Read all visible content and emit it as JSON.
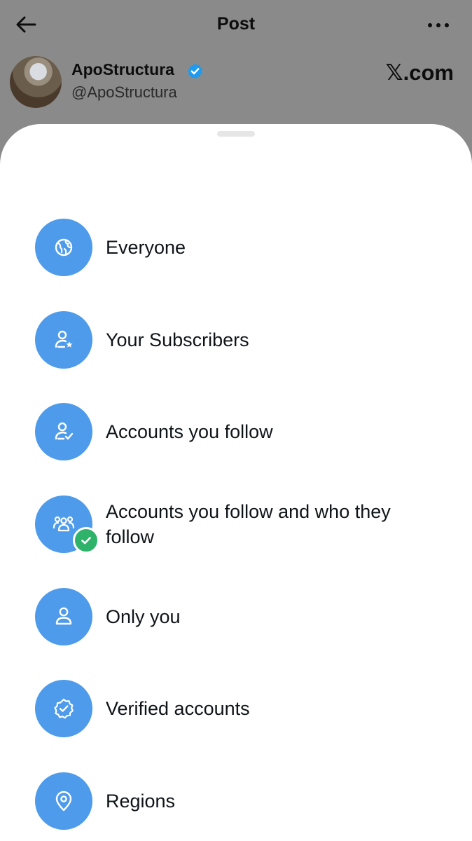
{
  "header": {
    "title": "Post"
  },
  "author": {
    "name": "ApoStructura",
    "handle": "@ApoStructura",
    "verified_color": "#1d9bf0"
  },
  "source": {
    "label": "𝕏.com"
  },
  "reply_options": {
    "accent_color": "#4d9bea",
    "selected_color": "#2fb36b",
    "items": [
      {
        "label": "Everyone",
        "icon": "globe-icon"
      },
      {
        "label": "Your Subscribers",
        "icon": "person-star-icon"
      },
      {
        "label": "Accounts you follow",
        "icon": "person-check-icon"
      },
      {
        "label": "Accounts you follow and who they follow",
        "icon": "people-group-icon",
        "selected": true
      },
      {
        "label": "Only you",
        "icon": "person-icon"
      },
      {
        "label": "Verified accounts",
        "icon": "verified-badge-icon"
      },
      {
        "label": "Regions",
        "icon": "location-pin-icon"
      }
    ]
  }
}
